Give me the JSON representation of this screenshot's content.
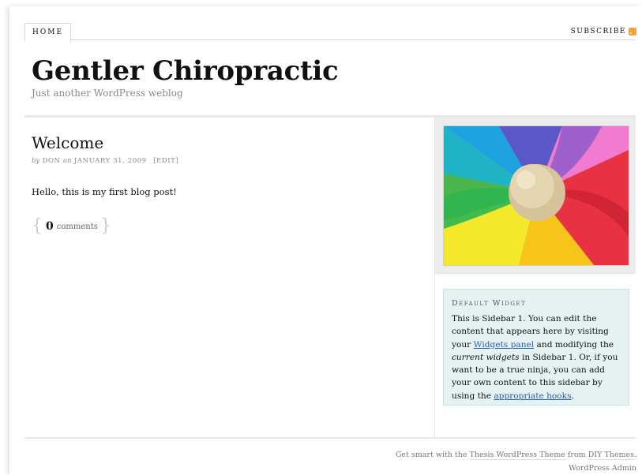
{
  "nav": {
    "home_label": "HOME",
    "subscribe_label": "SUBSCRIBE",
    "subscribe_icon": "rss-icon"
  },
  "header": {
    "site_title": "Gentler Chiropractic",
    "tagline": "Just another WordPress weblog"
  },
  "post": {
    "title": "Welcome",
    "by_word": "by",
    "author": "DON",
    "on_word": "on",
    "date": "JANUARY 31, 2009",
    "edit_label": "[EDIT]",
    "body": "Hello, this is my first blog post!",
    "comment_count": "0",
    "comment_label": "comments"
  },
  "sidebar": {
    "image_alt": "Colorful pinwheel with wooden ball",
    "widget": {
      "title": "Default Widget",
      "text_1": "This is Sidebar 1. You can edit the content that appears here by visiting your ",
      "link_1": "Widgets panel",
      "text_2": " and modifying the ",
      "em_1": "current widgets",
      "text_3": " in Sidebar 1. Or, if you want to be a true ninja, you can add your own content to this sidebar by using the ",
      "link_2": "appropriate hooks",
      "text_4": "."
    }
  },
  "footer": {
    "prefix": "Get smart with the ",
    "theme_link": "Thesis WordPress Theme",
    "middle": " from ",
    "diy_link": "DIY Themes",
    "suffix": ".",
    "admin_link": "WordPress Admin"
  },
  "colors": {
    "link": "#2a5db0",
    "widget_bg": "#e6f2f2",
    "rss": "#f5a23a"
  }
}
